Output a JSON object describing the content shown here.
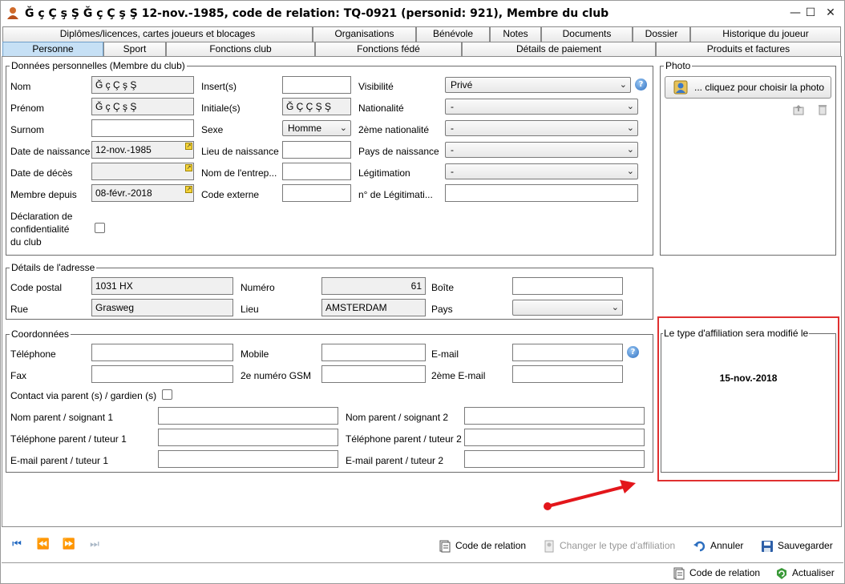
{
  "window": {
    "title": "Ğ ç Ç ş Ş Ğ ç Ç ş Ş 12-nov.-1985, code de relation: TQ-0921 (personid: 921), Membre du club",
    "minimize": "—",
    "maximize": "☐",
    "close": "✕"
  },
  "tabs_row1": [
    {
      "label": "Diplômes/licences, cartes joueurs et blocages"
    },
    {
      "label": "Organisations"
    },
    {
      "label": "Bénévole"
    },
    {
      "label": "Notes"
    },
    {
      "label": "Documents"
    },
    {
      "label": "Dossier"
    },
    {
      "label": "Historique du joueur"
    }
  ],
  "tabs_row2": [
    {
      "label": "Personne"
    },
    {
      "label": "Sport"
    },
    {
      "label": "Fonctions club"
    },
    {
      "label": "Fonctions fédé"
    },
    {
      "label": "Détails de paiement"
    },
    {
      "label": "Produits et factures"
    }
  ],
  "personal": {
    "title": "Données personnelles (Membre du club)",
    "nom_label": "Nom",
    "nom_value": "Ğ ç Ç ş Ş",
    "prenom_label": "Prénom",
    "prenom_value": "Ğ ç Ç ş Ş",
    "surnom_label": "Surnom",
    "surnom_value": "",
    "naissance_label": "Date de naissance",
    "naissance_value": "12-nov.-1985",
    "deces_label": "Date de décès",
    "deces_value": "",
    "membre_label": "Membre depuis",
    "membre_value": "08-févr.-2018",
    "decl_line1": "Déclaration de",
    "decl_line2": "confidentialité",
    "decl_line3": "du club",
    "inserts_label": "Insert(s)",
    "inserts_value": "",
    "initiales_label": "Initiale(s)",
    "initiales_value": "Ğ Ç Ç Ş Ş",
    "sexe_label": "Sexe",
    "sexe_value": "Homme",
    "lieu_naiss_label": "Lieu de naissance",
    "lieu_naiss_value": "",
    "entreprise_label": "Nom de l'entrep...",
    "entreprise_value": "",
    "code_ext_label": "Code externe",
    "code_ext_value": "",
    "visibilite_label": "Visibilité",
    "visibilite_value": "Privé",
    "nationalite_label": "Nationalité",
    "nationalite_value": "-",
    "nat2_label": "2ème nationalité",
    "nat2_value": "-",
    "pays_naiss_label": "Pays de naissance",
    "pays_naiss_value": "-",
    "legit_label": "Légitimation",
    "legit_value": "-",
    "legit_no_label": "n° de Légitimati...",
    "legit_no_value": ""
  },
  "photo": {
    "title": "Photo",
    "button_label": "... cliquez pour choisir la photo"
  },
  "address": {
    "title": "Détails de l'adresse",
    "cp_label": "Code postal",
    "cp_value": "1031 HX",
    "rue_label": "Rue",
    "rue_value": "Grasweg",
    "numero_label": "Numéro",
    "numero_value": "61",
    "lieu_label": "Lieu",
    "lieu_value": "AMSTERDAM",
    "boite_label": "Boîte",
    "boite_value": "",
    "pays_label": "Pays",
    "pays_value": ""
  },
  "contact": {
    "title": "Coordonnées",
    "tel_label": "Téléphone",
    "tel_value": "",
    "fax_label": "Fax",
    "fax_value": "",
    "mobile_label": "Mobile",
    "mobile_value": "",
    "gsm2_label": "2e numéro GSM",
    "gsm2_value": "",
    "email_label": "E-mail",
    "email_value": "",
    "email2_label": "2ème E-mail",
    "email2_value": "",
    "via_parent_label": "Contact via parent (s) / gardien (s)",
    "parent1_name_label": "Nom parent / soignant 1",
    "parent1_name_value": "",
    "parent1_tel_label": "Téléphone parent / tuteur 1",
    "parent1_tel_value": "",
    "parent1_mail_label": "E-mail parent / tuteur 1",
    "parent1_mail_value": "",
    "parent2_name_label": "Nom parent / soignant 2",
    "parent2_name_value": "",
    "parent2_tel_label": "Téléphone parent / tuteur 2",
    "parent2_tel_value": "",
    "parent2_mail_label": "E-mail parent / tuteur 2",
    "parent2_mail_value": ""
  },
  "affiliation": {
    "title": "Le type d'affiliation sera modifié le",
    "date": "15-nov.-2018"
  },
  "toolbar": {
    "code_relation": "Code de relation",
    "changer_type": "Changer le type d'affiliation",
    "annuler": "Annuler",
    "sauvegarder": "Sauvegarder"
  },
  "statusbar": {
    "code_relation": "Code de relation",
    "actualiser": "Actualiser"
  },
  "colors": {
    "highlight_border": "#e03030",
    "arrow": "#e3161b",
    "active_tab": "#c6e0f5"
  }
}
